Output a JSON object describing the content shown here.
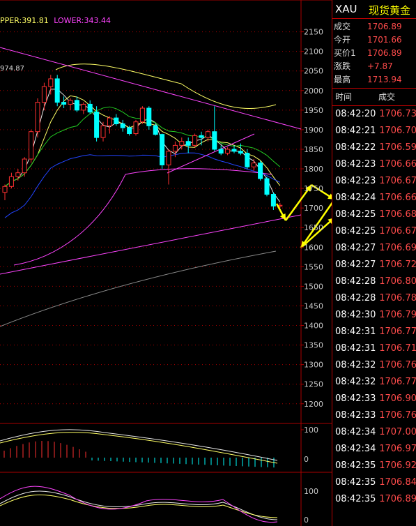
{
  "indicators": {
    "upper": "PPER:391.81",
    "lower": "LOWER:343.44",
    "peak_label": "974.87"
  },
  "price_axis": {
    "labels": [
      "2150",
      "2100",
      "2050",
      "2000",
      "1950",
      "1900",
      "1850",
      "1800",
      "1750",
      "1700",
      "1650",
      "1600",
      "1550",
      "1500",
      "1450",
      "1400",
      "1350",
      "1300",
      "1250",
      "1200"
    ]
  },
  "sub1_axis": {
    "labels": [
      "100",
      "0"
    ]
  },
  "sub2_axis": {
    "labels": [
      "100",
      "0"
    ]
  },
  "colors": {
    "up": "#ff3030",
    "down": "#00ffff",
    "grid": "#aa0000",
    "trendline": "#ff44ff",
    "ma_yellow": "#ffff66",
    "ma_white": "#e8e8e8",
    "ma_green": "#22cc22",
    "ma_blue": "#2244ff",
    "ma_gray": "#8a8a8a",
    "arrow": "#ffff00"
  },
  "quote": {
    "symbol": "XAU",
    "name": "现货黄金",
    "rows": [
      {
        "label": "成交",
        "value": "1706.89"
      },
      {
        "label": "今开",
        "value": "1701.66"
      },
      {
        "label": "买价1",
        "value": "1706.89"
      },
      {
        "label": "涨跌",
        "value": "+7.87"
      },
      {
        "label": "最高",
        "value": "1713.94"
      }
    ]
  },
  "ticks": {
    "header_time": "时间",
    "header_price": "成交",
    "rows": [
      {
        "time": "08:42:20",
        "price": "1706.73"
      },
      {
        "time": "08:42:21",
        "price": "1706.70"
      },
      {
        "time": "08:42:22",
        "price": "1706.59"
      },
      {
        "time": "08:42:23",
        "price": "1706.66"
      },
      {
        "time": "08:42:23",
        "price": "1706.67"
      },
      {
        "time": "08:42:24",
        "price": "1706.66"
      },
      {
        "time": "08:42:25",
        "price": "1706.68"
      },
      {
        "time": "08:42:25",
        "price": "1706.67"
      },
      {
        "time": "08:42:27",
        "price": "1706.69"
      },
      {
        "time": "08:42:27",
        "price": "1706.72"
      },
      {
        "time": "08:42:28",
        "price": "1706.80"
      },
      {
        "time": "08:42:28",
        "price": "1706.78"
      },
      {
        "time": "08:42:30",
        "price": "1706.79"
      },
      {
        "time": "08:42:31",
        "price": "1706.77"
      },
      {
        "time": "08:42:31",
        "price": "1706.71"
      },
      {
        "time": "08:42:32",
        "price": "1706.76"
      },
      {
        "time": "08:42:32",
        "price": "1706.77"
      },
      {
        "time": "08:42:33",
        "price": "1706.90"
      },
      {
        "time": "08:42:33",
        "price": "1706.76"
      },
      {
        "time": "08:42:34",
        "price": "1707.00"
      },
      {
        "time": "08:42:34",
        "price": "1706.97"
      },
      {
        "time": "08:42:35",
        "price": "1706.92"
      },
      {
        "time": "08:42:35",
        "price": "1706.84"
      },
      {
        "time": "08:42:35",
        "price": "1706.89"
      }
    ]
  },
  "chart_data": {
    "type": "candlestick",
    "y_range": [
      1180,
      2160
    ],
    "candles": [
      {
        "o": 1740,
        "h": 1760,
        "l": 1720,
        "c": 1755
      },
      {
        "o": 1755,
        "h": 1790,
        "l": 1750,
        "c": 1780
      },
      {
        "o": 1780,
        "h": 1800,
        "l": 1770,
        "c": 1790
      },
      {
        "o": 1790,
        "h": 1830,
        "l": 1780,
        "c": 1825
      },
      {
        "o": 1825,
        "h": 1900,
        "l": 1815,
        "c": 1895
      },
      {
        "o": 1895,
        "h": 1980,
        "l": 1880,
        "c": 1970
      },
      {
        "o": 1970,
        "h": 2020,
        "l": 1950,
        "c": 2010
      },
      {
        "o": 2010,
        "h": 2040,
        "l": 1990,
        "c": 2030
      },
      {
        "o": 2030,
        "h": 2040,
        "l": 1960,
        "c": 1970
      },
      {
        "o": 1970,
        "h": 1985,
        "l": 1955,
        "c": 1965
      },
      {
        "o": 1965,
        "h": 1980,
        "l": 1950,
        "c": 1975
      },
      {
        "o": 1975,
        "h": 1985,
        "l": 1945,
        "c": 1950
      },
      {
        "o": 1950,
        "h": 1970,
        "l": 1940,
        "c": 1965
      },
      {
        "o": 1965,
        "h": 1975,
        "l": 1940,
        "c": 1945
      },
      {
        "o": 1945,
        "h": 1960,
        "l": 1870,
        "c": 1880
      },
      {
        "o": 1880,
        "h": 1920,
        "l": 1870,
        "c": 1910
      },
      {
        "o": 1910,
        "h": 1935,
        "l": 1890,
        "c": 1930
      },
      {
        "o": 1930,
        "h": 1940,
        "l": 1910,
        "c": 1915
      },
      {
        "o": 1915,
        "h": 1925,
        "l": 1895,
        "c": 1905
      },
      {
        "o": 1905,
        "h": 1910,
        "l": 1885,
        "c": 1890
      },
      {
        "o": 1890,
        "h": 1925,
        "l": 1885,
        "c": 1920
      },
      {
        "o": 1920,
        "h": 1960,
        "l": 1915,
        "c": 1955
      },
      {
        "o": 1955,
        "h": 1960,
        "l": 1900,
        "c": 1910
      },
      {
        "o": 1910,
        "h": 1915,
        "l": 1885,
        "c": 1888
      },
      {
        "o": 1888,
        "h": 1890,
        "l": 1800,
        "c": 1810
      },
      {
        "o": 1810,
        "h": 1850,
        "l": 1760,
        "c": 1845
      },
      {
        "o": 1845,
        "h": 1870,
        "l": 1830,
        "c": 1860
      },
      {
        "o": 1860,
        "h": 1880,
        "l": 1850,
        "c": 1870
      },
      {
        "o": 1870,
        "h": 1880,
        "l": 1840,
        "c": 1860
      },
      {
        "o": 1860,
        "h": 1890,
        "l": 1855,
        "c": 1885
      },
      {
        "o": 1885,
        "h": 1895,
        "l": 1860,
        "c": 1880
      },
      {
        "o": 1880,
        "h": 1900,
        "l": 1870,
        "c": 1895
      },
      {
        "o": 1895,
        "h": 1960,
        "l": 1845,
        "c": 1850
      },
      {
        "o": 1850,
        "h": 1860,
        "l": 1835,
        "c": 1840
      },
      {
        "o": 1840,
        "h": 1855,
        "l": 1835,
        "c": 1850
      },
      {
        "o": 1850,
        "h": 1860,
        "l": 1840,
        "c": 1845
      },
      {
        "o": 1845,
        "h": 1865,
        "l": 1835,
        "c": 1840
      },
      {
        "o": 1840,
        "h": 1850,
        "l": 1800,
        "c": 1805
      },
      {
        "o": 1805,
        "h": 1825,
        "l": 1795,
        "c": 1815
      },
      {
        "o": 1815,
        "h": 1820,
        "l": 1770,
        "c": 1775
      },
      {
        "o": 1775,
        "h": 1780,
        "l": 1730,
        "c": 1735
      },
      {
        "o": 1735,
        "h": 1740,
        "l": 1695,
        "c": 1705
      },
      {
        "o": 1705,
        "h": 1713,
        "l": 1700,
        "c": 1707
      }
    ]
  }
}
